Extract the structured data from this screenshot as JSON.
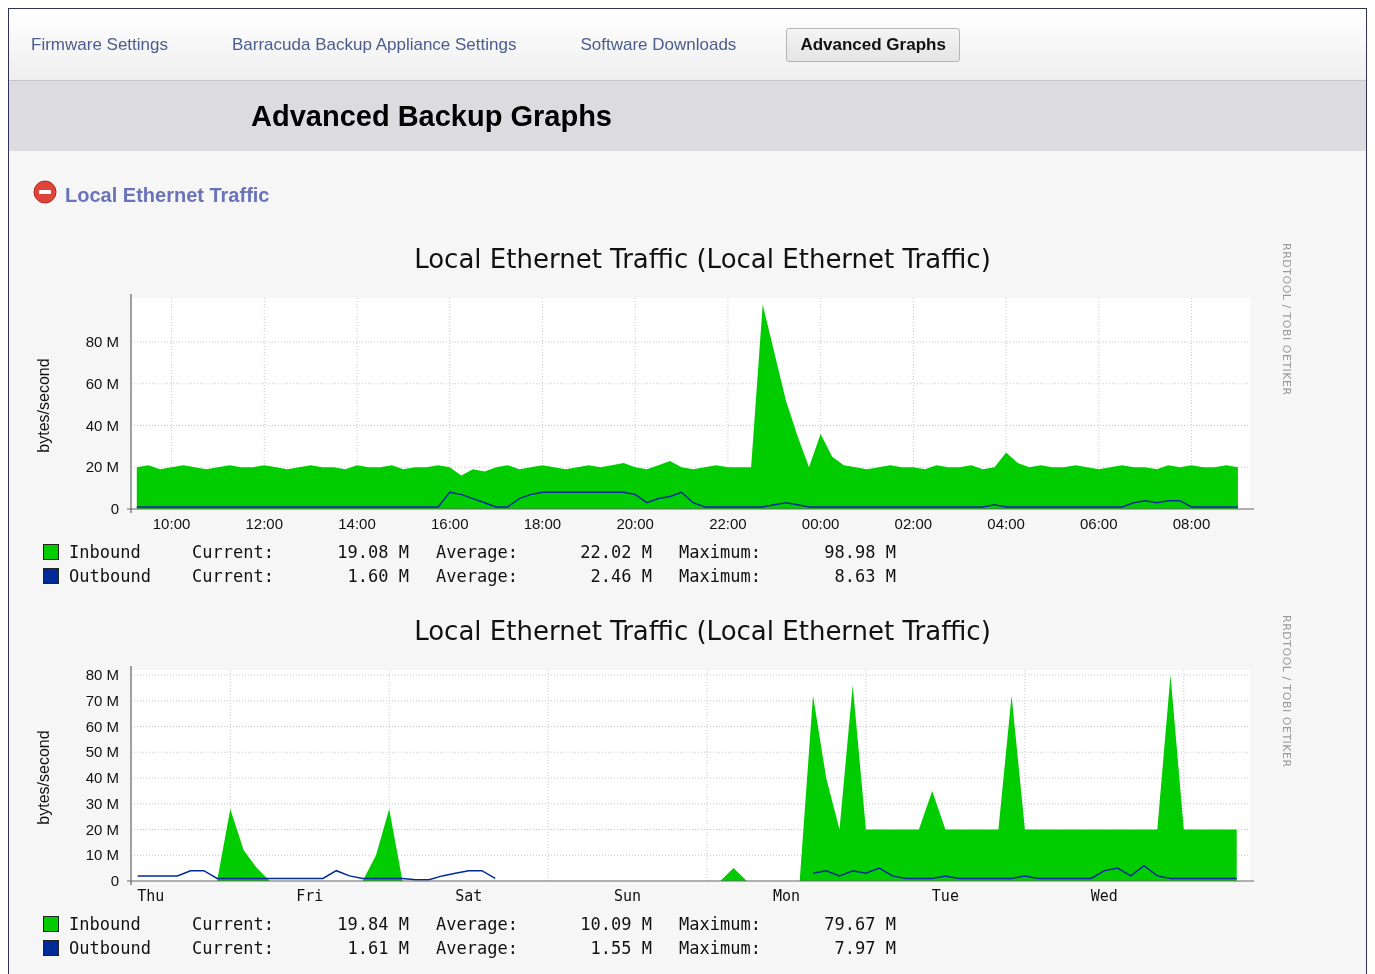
{
  "tabs": [
    {
      "label": "Firmware Settings",
      "selected": false
    },
    {
      "label": "Barracuda Backup Appliance Settings",
      "selected": false
    },
    {
      "label": "Software Downloads",
      "selected": false
    },
    {
      "label": "Advanced Graphs",
      "selected": true
    }
  ],
  "page_title": "Advanced Backup Graphs",
  "section": {
    "title": "Local Ethernet Traffic",
    "expanded": true
  },
  "graphs": [
    {
      "watermark": "RRDTOOL / TOBI OETIKER",
      "chart_data": {
        "type": "area",
        "title": "Local Ethernet Traffic (Local Ethernet Traffic)",
        "ylabel": "bytes/second",
        "grid": "at_labels",
        "categories": [
          null,
          null,
          null,
          "10:00",
          null,
          null,
          null,
          null,
          null,
          null,
          null,
          "12:00",
          null,
          null,
          null,
          null,
          null,
          null,
          null,
          "14:00",
          null,
          null,
          null,
          null,
          null,
          null,
          null,
          "16:00",
          null,
          null,
          null,
          null,
          null,
          null,
          null,
          "18:00",
          null,
          null,
          null,
          null,
          null,
          null,
          null,
          "20:00",
          null,
          null,
          null,
          null,
          null,
          null,
          null,
          "22:00",
          null,
          null,
          null,
          null,
          null,
          null,
          null,
          "00:00",
          null,
          null,
          null,
          null,
          null,
          null,
          null,
          "02:00",
          null,
          null,
          null,
          null,
          null,
          null,
          null,
          "04:00",
          null,
          null,
          null,
          null,
          null,
          null,
          null,
          "06:00",
          null,
          null,
          null,
          null,
          null,
          null,
          null,
          "08:00",
          null,
          null,
          null,
          null
        ],
        "series": [
          {
            "name": "Inbound",
            "type": "area",
            "color": "#00cc00",
            "values": [
              20,
              21,
              19,
              20,
              21,
              20,
              19,
              20,
              21,
              20,
              20,
              21,
              20,
              19,
              20,
              21,
              20,
              20,
              19,
              21,
              20,
              20,
              21,
              19,
              20,
              20,
              21,
              20,
              16,
              19,
              18,
              20,
              21,
              19,
              20,
              21,
              20,
              19,
              20,
              21,
              20,
              21,
              22,
              20,
              19,
              21,
              23,
              20,
              19,
              20,
              21,
              20,
              20,
              20,
              98,
              75,
              52,
              35,
              20,
              36,
              25,
              21,
              20,
              19,
              20,
              21,
              20,
              20,
              19,
              21,
              20,
              20,
              21,
              19,
              20,
              27,
              22,
              20,
              21,
              20,
              20,
              21,
              20,
              19,
              20,
              21,
              20,
              20,
              19,
              21,
              20,
              21,
              20,
              20,
              21,
              20
            ]
          },
          {
            "name": "Outbound",
            "type": "line",
            "color": "#002a97",
            "values": [
              1,
              1,
              1,
              1,
              1,
              1,
              1,
              1,
              1,
              1,
              1,
              1,
              1,
              1,
              1,
              1,
              1,
              1,
              1,
              1,
              1,
              1,
              1,
              1,
              1,
              1,
              1,
              8,
              7,
              5,
              3,
              1,
              1,
              5,
              7,
              8,
              8,
              8,
              8,
              8,
              8,
              8,
              8,
              7,
              3,
              5,
              6,
              8,
              3,
              1,
              1,
              1,
              1,
              1,
              1,
              2,
              3,
              2,
              1,
              1,
              1,
              1,
              1,
              1,
              1,
              1,
              1,
              1,
              1,
              1,
              1,
              1,
              1,
              1,
              2,
              1,
              1,
              1,
              1,
              1,
              1,
              1,
              1,
              1,
              1,
              1,
              3,
              4,
              3,
              4,
              4,
              1,
              1,
              1,
              1,
              1
            ]
          }
        ],
        "ylim": [
          0,
          103
        ],
        "yticks": [
          {
            "value": 0,
            "label": "0"
          },
          {
            "value": 20,
            "label": "20 M"
          },
          {
            "value": 40,
            "label": "40 M"
          },
          {
            "value": 60,
            "label": "60 M"
          },
          {
            "value": 80,
            "label": "80 M"
          }
        ]
      },
      "legend": [
        {
          "current_label": "Current:",
          "current": "19.08 M",
          "average_label": "Average:",
          "average": "22.02 M",
          "maximum_label": "Maximum:",
          "maximum": "98.98 M"
        },
        {
          "current_label": "Current:",
          "current": "1.60 M",
          "average_label": "Average:",
          "average": "2.46 M",
          "maximum_label": "Maximum:",
          "maximum": "8.63 M"
        }
      ]
    },
    {
      "watermark": "RRDTOOL / TOBI OETIKER",
      "chart_data": {
        "type": "area",
        "title": "Local Ethernet Traffic (Local Ethernet Traffic)",
        "ylabel": "bytes/second",
        "grid": "between_labels",
        "categories": [
          null,
          "Thu",
          null,
          null,
          null,
          null,
          null,
          null,
          null,
          null,
          null,
          null,
          null,
          "Fri",
          null,
          null,
          null,
          null,
          null,
          null,
          null,
          null,
          null,
          null,
          null,
          "Sat",
          null,
          null,
          null,
          null,
          null,
          null,
          null,
          null,
          null,
          null,
          null,
          "Sun",
          null,
          null,
          null,
          null,
          null,
          null,
          null,
          null,
          null,
          null,
          null,
          "Mon",
          null,
          null,
          null,
          null,
          null,
          null,
          null,
          null,
          null,
          null,
          null,
          "Tue",
          null,
          null,
          null,
          null,
          null,
          null,
          null,
          null,
          null,
          null,
          null,
          "Wed",
          null,
          null,
          null,
          null,
          null,
          null,
          null,
          null,
          null,
          null
        ],
        "series": [
          {
            "name": "Inbound",
            "type": "area",
            "color": "#00cc00",
            "values": [
              0,
              0,
              0,
              0,
              0,
              0,
              0,
              28,
              12,
              5,
              0,
              0,
              0,
              0,
              0,
              0,
              0,
              0,
              10,
              28,
              0,
              0,
              0,
              0,
              0,
              0,
              0,
              0,
              0,
              0,
              0,
              0,
              0,
              0,
              0,
              0,
              0,
              0,
              0,
              0,
              0,
              0,
              0,
              0,
              0,
              5,
              0,
              0,
              0,
              0,
              0,
              72,
              40,
              20,
              76,
              20,
              20,
              20,
              20,
              20,
              35,
              20,
              20,
              20,
              20,
              20,
              72,
              20,
              20,
              20,
              20,
              20,
              20,
              20,
              20,
              20,
              20,
              20,
              80,
              20,
              20,
              20,
              20,
              20
            ]
          },
          {
            "name": "Outbound",
            "type": "line",
            "color": "#002a97",
            "values": [
              2,
              2,
              2,
              2,
              4,
              4,
              1,
              1,
              1,
              1,
              1,
              1,
              1,
              1,
              1,
              4,
              2,
              1,
              1,
              1,
              1,
              0.5,
              0.5,
              2,
              3,
              4,
              4,
              1,
              null,
              null,
              null,
              null,
              null,
              null,
              null,
              null,
              null,
              null,
              null,
              null,
              null,
              null,
              null,
              null,
              null,
              null,
              null,
              null,
              null,
              null,
              null,
              3,
              4,
              2,
              4,
              3,
              5,
              2,
              1,
              1,
              1,
              2,
              1,
              1,
              1,
              1,
              1,
              2,
              1,
              1,
              1,
              1,
              1,
              4,
              5,
              2,
              6,
              2,
              1,
              1,
              1,
              1,
              1,
              1
            ]
          }
        ],
        "ylim": [
          0,
          83.5
        ],
        "yticks": [
          {
            "value": 0,
            "label": "0"
          },
          {
            "value": 10,
            "label": "10 M"
          },
          {
            "value": 20,
            "label": "20 M"
          },
          {
            "value": 30,
            "label": "30 M"
          },
          {
            "value": 40,
            "label": "40 M"
          },
          {
            "value": 50,
            "label": "50 M"
          },
          {
            "value": 60,
            "label": "60 M"
          },
          {
            "value": 70,
            "label": "70 M"
          },
          {
            "value": 80,
            "label": "80 M"
          }
        ]
      },
      "legend": [
        {
          "current_label": "Current:",
          "current": "19.84 M",
          "average_label": "Average:",
          "average": "10.09 M",
          "maximum_label": "Maximum:",
          "maximum": "79.67 M"
        },
        {
          "current_label": "Current:",
          "current": "1.61 M",
          "average_label": "Average:",
          "average": "1.55 M",
          "maximum_label": "Maximum:",
          "maximum": "7.97 M"
        }
      ]
    }
  ]
}
